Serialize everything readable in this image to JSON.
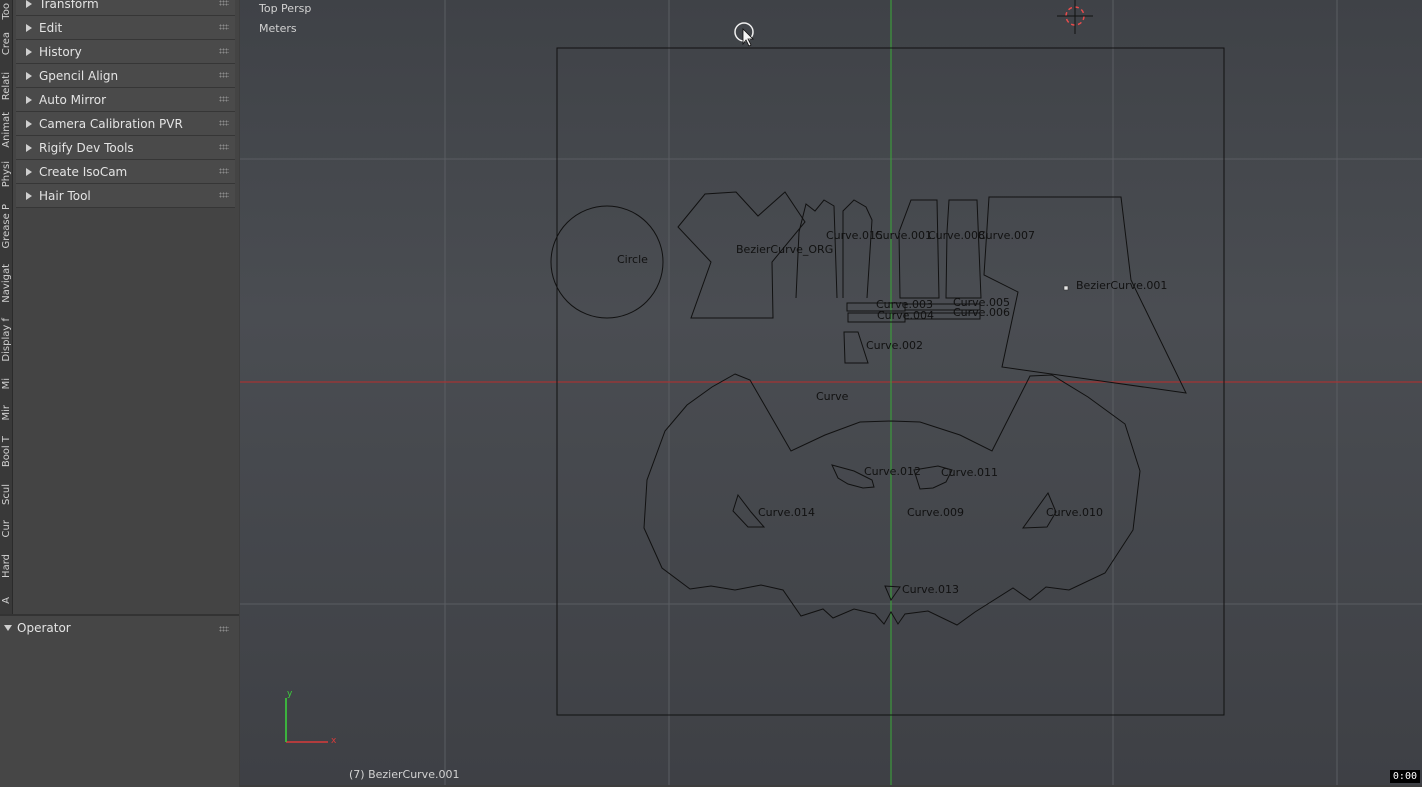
{
  "tabs": [
    "Too",
    "Crea",
    "Relati",
    "Animat",
    "Physi",
    "Grease P",
    "Navigat",
    "Display f",
    "Mi",
    "Mir",
    "Bool T",
    "Scul",
    "Cur",
    "Hard",
    "A"
  ],
  "panels": [
    "Transform",
    "Edit",
    "History",
    "Gpencil Align",
    "Auto Mirror",
    "Camera Calibration PVR",
    "Rigify Dev Tools",
    "Create IsoCam",
    "Hair Tool"
  ],
  "operator": {
    "title": "Operator"
  },
  "viewport": {
    "view_name": "Top Persp",
    "units": "Meters",
    "status": "(7) BezierCurve.001",
    "timer": "0:00",
    "axis_x": "x",
    "axis_y": "y"
  },
  "objects": {
    "circle": "Circle",
    "bezier_org": "BezierCurve_ORG",
    "curve_015": "Curve.015",
    "curve_001": "Curve.001",
    "curve_008": "Curve.008",
    "curve_007": "Curve.007",
    "bezier_001": "BezierCurve.001",
    "curve_003": "Curve.003",
    "curve_004": "Curve.004",
    "curve_005": "Curve.005",
    "curve_006": "Curve.006",
    "curve_002": "Curve.002",
    "curve": "Curve",
    "curve_012": "Curve.012",
    "curve_011": "Curve.011",
    "curve_014": "Curve.014",
    "curve_009": "Curve.009",
    "curve_010": "Curve.010",
    "curve_013": "Curve.013"
  },
  "colors": {
    "x_axis": "#b03030",
    "y_axis": "#3c9a3c",
    "wire": "#111111"
  }
}
